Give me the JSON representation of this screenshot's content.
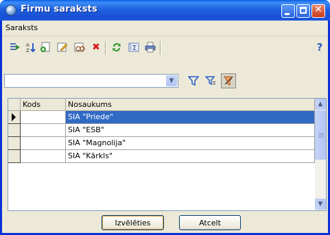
{
  "window": {
    "title": "Firmu saraksts"
  },
  "menu": {
    "items": [
      "Saraksts"
    ]
  },
  "toolbar": {
    "icons": [
      "export-icon",
      "sort-icon",
      "add-record-icon",
      "edit-icon",
      "view-icon",
      "delete-icon",
      "refresh-icon",
      "sum-icon",
      "print-icon",
      "help-icon"
    ],
    "help_label": "?"
  },
  "filter": {
    "combo_value": ""
  },
  "grid": {
    "columns": [
      "Kods",
      "Nosaukums"
    ],
    "rows": [
      {
        "kods": "",
        "nosaukums": "SIA \"Priede\"",
        "selected": true
      },
      {
        "kods": "",
        "nosaukums": "SIA \"ESB\"",
        "selected": false
      },
      {
        "kods": "",
        "nosaukums": "SIA \"Magnolija\"",
        "selected": false
      },
      {
        "kods": "",
        "nosaukums": "SIA \"Kārkls\"",
        "selected": false
      }
    ]
  },
  "buttons": {
    "choose": "Izvēlēties",
    "cancel": "Atcelt"
  },
  "colors": {
    "selection": "#316ac5",
    "titlebar": "#1f62e0",
    "accent_close": "#c8381a"
  }
}
